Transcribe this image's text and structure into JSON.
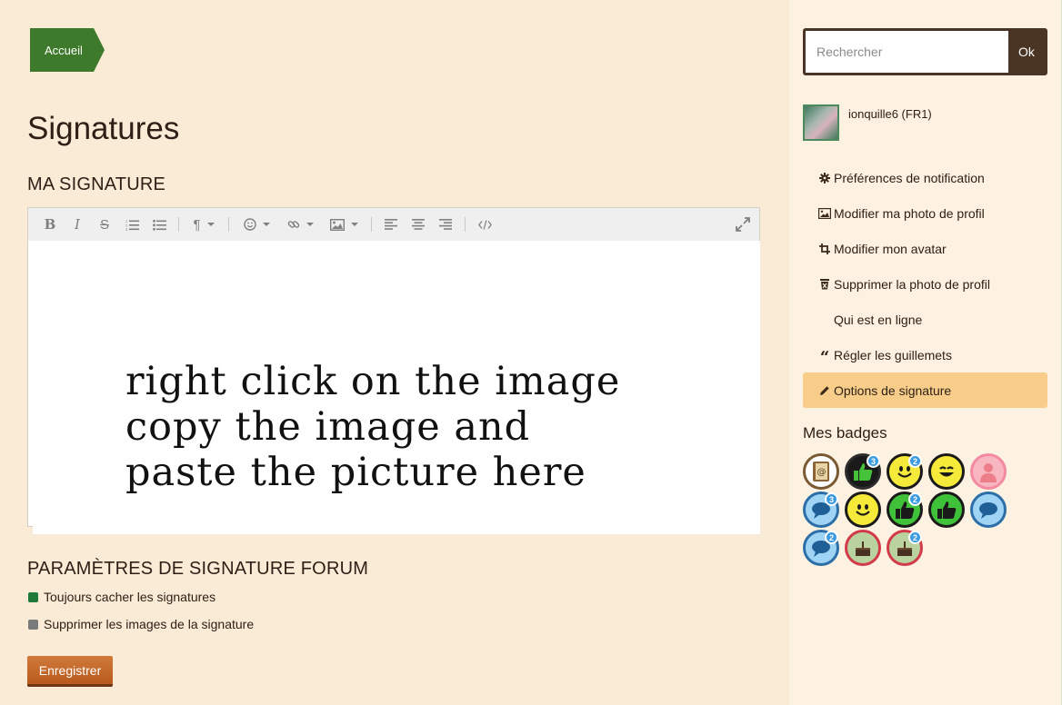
{
  "breadcrumb": {
    "home": "Accueil"
  },
  "page": {
    "title": "Signatures",
    "my_signature_heading": "MA SIGNATURE",
    "signature_lines": [
      "right click on the image",
      "copy the image and",
      "paste the picture here"
    ],
    "forum_settings_heading": "PARAMÈTRES DE SIGNATURE FORUM",
    "options": [
      {
        "label": "Toujours cacher les signatures",
        "color": "#1f7a3a"
      },
      {
        "label": "Supprimer les images de la signature",
        "color": "#7a7a7a"
      }
    ],
    "save_label": "Enregistrer"
  },
  "toolbar": {
    "icons": [
      "bold-icon",
      "italic-icon",
      "strikethrough-icon",
      "ordered-list-icon",
      "unordered-list-icon",
      "paragraph-icon",
      "emoji-icon",
      "link-icon",
      "image-icon",
      "align-left-icon",
      "align-center-icon",
      "align-right-icon",
      "code-icon",
      "fullscreen-icon"
    ]
  },
  "sidebar": {
    "search": {
      "placeholder": "Rechercher",
      "button": "Ok"
    },
    "user": {
      "name": "ionquille6 (FR1)"
    },
    "menu": [
      {
        "label": "Préférences de notification",
        "icon": "gear-icon"
      },
      {
        "label": "Modifier ma photo de profil",
        "icon": "picture-icon"
      },
      {
        "label": "Modifier mon avatar",
        "icon": "crop-icon"
      },
      {
        "label": "Supprimer la photo de profil",
        "icon": "trash-icon"
      },
      {
        "label": "Qui est en ligne",
        "icon": ""
      },
      {
        "label": "Régler les guillemets",
        "icon": "quote-icon"
      },
      {
        "label": "Options de signature",
        "icon": "pencil-icon",
        "active": true
      }
    ],
    "badges_title": "Mes badges",
    "badges": [
      {
        "type": "contact-book",
        "count": ""
      },
      {
        "type": "thumbs-up-dark",
        "count": "3"
      },
      {
        "type": "smiley-yellow",
        "count": "2"
      },
      {
        "type": "grin-yellow",
        "count": ""
      },
      {
        "type": "person-pink",
        "count": ""
      },
      {
        "type": "chat-blue",
        "count": "3"
      },
      {
        "type": "smiley-yellow",
        "count": ""
      },
      {
        "type": "thumbs-up-green",
        "count": "2"
      },
      {
        "type": "thumbs-up-green",
        "count": ""
      },
      {
        "type": "chat-blue",
        "count": ""
      },
      {
        "type": "chat-blue",
        "count": "2"
      },
      {
        "type": "cake-red",
        "count": ""
      },
      {
        "type": "cake-red",
        "count": "2"
      }
    ]
  }
}
